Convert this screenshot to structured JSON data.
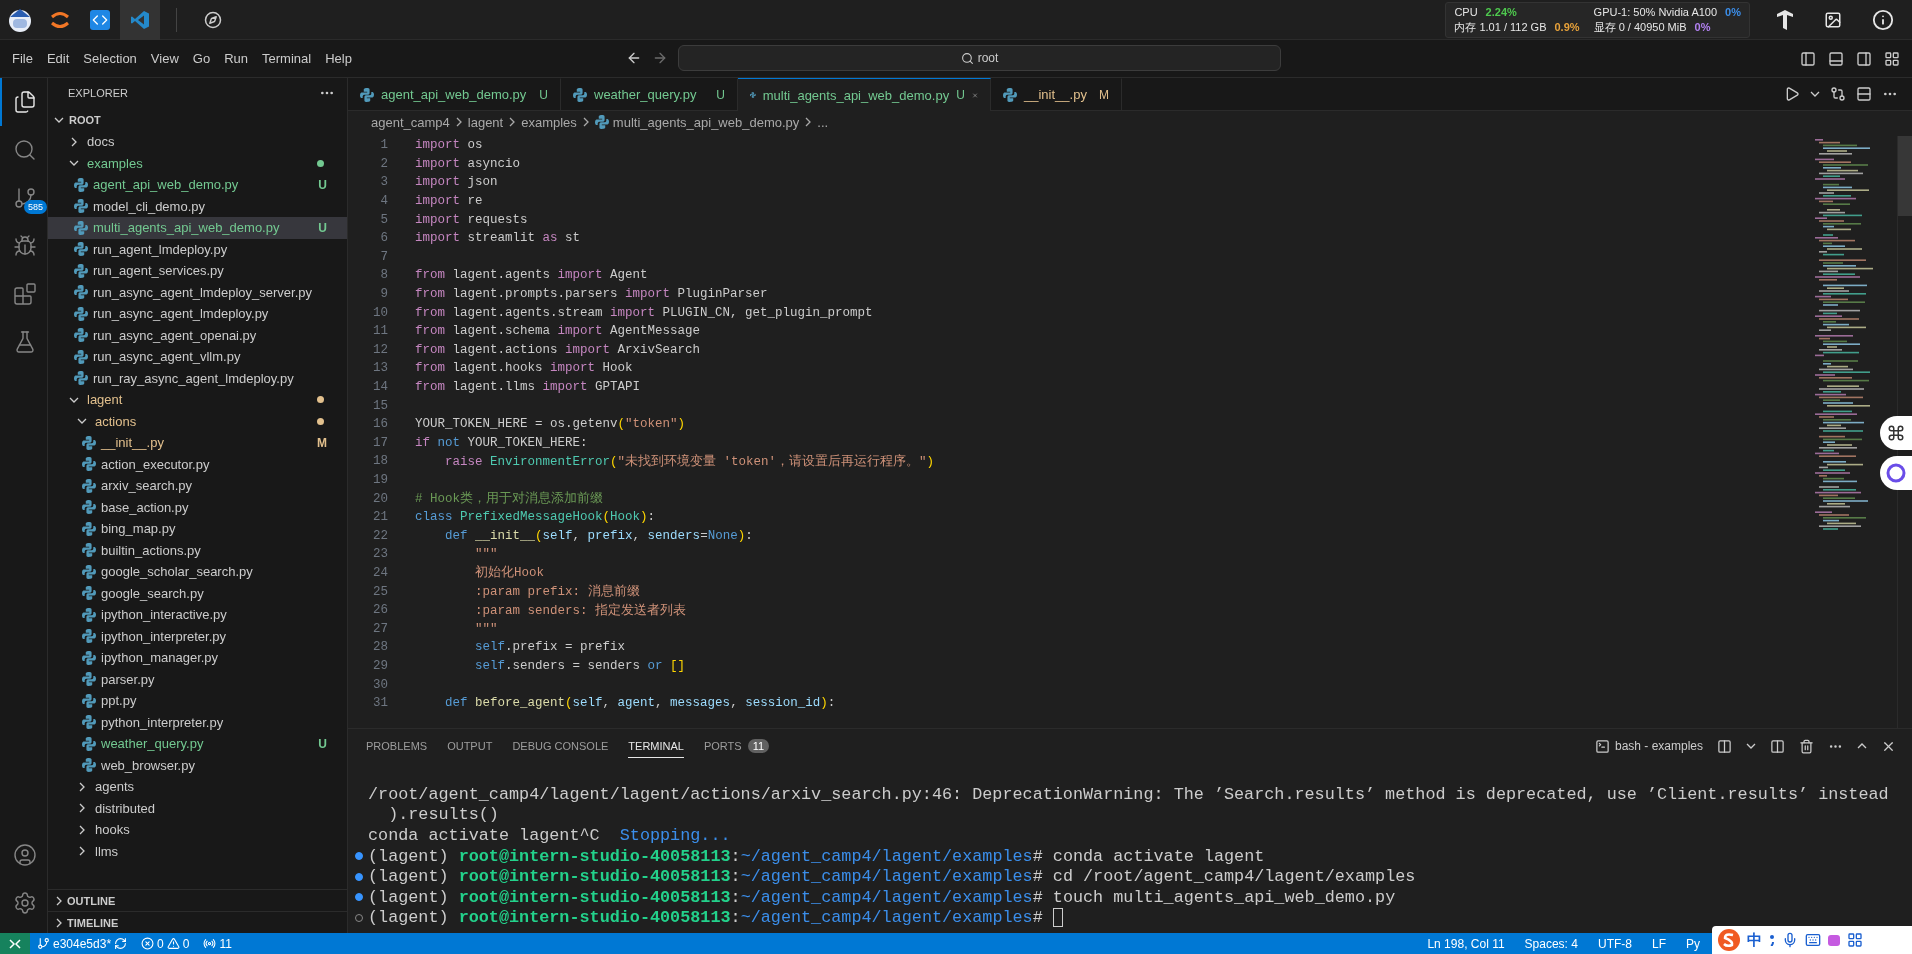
{
  "system_bar": {
    "apps": [
      {
        "kind": "mascot",
        "selected": false
      },
      {
        "kind": "jupyter",
        "selected": false
      },
      {
        "kind": "code",
        "selected": false
      },
      {
        "kind": "vscode",
        "selected": true
      },
      {
        "kind": "compass",
        "selected": false
      }
    ],
    "stats": [
      {
        "label": "CPU",
        "value": "2.24%",
        "color": "#4ec94e"
      },
      {
        "label": "GPU-1: 50% Nvidia A100",
        "value": "0%",
        "color": "#3b8eea"
      },
      {
        "label": "内存 1.01 / 112 GB",
        "value": "0.9%",
        "color": "#e8a23a"
      },
      {
        "label": "显存 0 / 40950 MiB",
        "value": "0%",
        "color": "#b180f0"
      }
    ]
  },
  "menu": [
    "File",
    "Edit",
    "Selection",
    "View",
    "Go",
    "Run",
    "Terminal",
    "Help"
  ],
  "command_center": {
    "text": "root"
  },
  "activity_bar": [
    {
      "kind": "explorer",
      "selected": true
    },
    {
      "kind": "search",
      "selected": false
    },
    {
      "kind": "source_control",
      "selected": false,
      "badge": "585"
    },
    {
      "kind": "run_debug",
      "selected": false
    },
    {
      "kind": "extensions",
      "selected": false
    },
    {
      "kind": "testing",
      "selected": false
    }
  ],
  "explorer": {
    "title": "EXPLORER",
    "root": "ROOT",
    "tree": [
      {
        "label": "docs",
        "kind": "folder",
        "expanded": false,
        "selected": false
      },
      {
        "label": "examples",
        "kind": "folder",
        "expanded": true,
        "selected": false,
        "color": "#73c991",
        "children": [
          {
            "label": "agent_api_web_demo.py",
            "kind": "file",
            "selected": false,
            "color": "#73c991",
            "badge": "U"
          },
          {
            "label": "model_cli_demo.py",
            "kind": "file",
            "selected": false
          },
          {
            "label": "multi_agents_api_web_demo.py",
            "kind": "file",
            "selected": true,
            "color": "#73c991",
            "badge": "U"
          },
          {
            "label": "run_agent_lmdeploy.py",
            "kind": "file",
            "selected": false
          },
          {
            "label": "run_agent_services.py",
            "kind": "file",
            "selected": false
          },
          {
            "label": "run_async_agent_lmdeploy_server.py",
            "kind": "file",
            "selected": false
          },
          {
            "label": "run_async_agent_lmdeploy.py",
            "kind": "file",
            "selected": false
          },
          {
            "label": "run_async_agent_openai.py",
            "kind": "file",
            "selected": false
          },
          {
            "label": "run_async_agent_vllm.py",
            "kind": "file",
            "selected": false
          },
          {
            "label": "run_ray_async_agent_lmdeploy.py",
            "kind": "file",
            "selected": false
          }
        ]
      },
      {
        "label": "lagent",
        "kind": "folder",
        "expanded": true,
        "selected": false,
        "color": "#e2c08d",
        "children": [
          {
            "label": "actions",
            "kind": "folder",
            "expanded": true,
            "selected": false,
            "color": "#e2c08d",
            "children": [
              {
                "label": "__init__.py",
                "kind": "file",
                "selected": false,
                "color": "#e2c08d",
                "badge": "M"
              },
              {
                "label": "action_executor.py",
                "kind": "file",
                "selected": false
              },
              {
                "label": "arxiv_search.py",
                "kind": "file",
                "selected": false
              },
              {
                "label": "base_action.py",
                "kind": "file",
                "selected": false
              },
              {
                "label": "bing_map.py",
                "kind": "file",
                "selected": false
              },
              {
                "label": "builtin_actions.py",
                "kind": "file",
                "selected": false
              },
              {
                "label": "google_scholar_search.py",
                "kind": "file",
                "selected": false
              },
              {
                "label": "google_search.py",
                "kind": "file",
                "selected": false
              },
              {
                "label": "ipython_interactive.py",
                "kind": "file",
                "selected": false
              },
              {
                "label": "ipython_interpreter.py",
                "kind": "file",
                "selected": false
              },
              {
                "label": "ipython_manager.py",
                "kind": "file",
                "selected": false
              },
              {
                "label": "parser.py",
                "kind": "file",
                "selected": false
              },
              {
                "label": "ppt.py",
                "kind": "file",
                "selected": false
              },
              {
                "label": "python_interpreter.py",
                "kind": "file",
                "selected": false
              },
              {
                "label": "weather_query.py",
                "kind": "file",
                "selected": false,
                "color": "#73c991",
                "badge": "U"
              },
              {
                "label": "web_browser.py",
                "kind": "file",
                "selected": false
              }
            ]
          },
          {
            "label": "agents",
            "kind": "folder",
            "expanded": false,
            "selected": false
          },
          {
            "label": "distributed",
            "kind": "folder",
            "expanded": false,
            "selected": false
          },
          {
            "label": "hooks",
            "kind": "folder",
            "expanded": false,
            "selected": false
          },
          {
            "label": "llms",
            "kind": "folder",
            "expanded": false,
            "selected": false
          }
        ]
      }
    ],
    "sections": [
      {
        "label": "OUTLINE",
        "expanded": false
      },
      {
        "label": "TIMELINE",
        "expanded": false
      }
    ]
  },
  "tabs": [
    {
      "label": "agent_api_web_demo.py",
      "badge": "U",
      "color": "#73c991",
      "selected": false
    },
    {
      "label": "weather_query.py",
      "badge": "U",
      "color": "#73c991",
      "selected": false
    },
    {
      "label": "multi_agents_api_web_demo.py",
      "badge": "U",
      "color": "#73c991",
      "selected": true
    },
    {
      "label": "__init__.py",
      "badge": "M",
      "color": "#e2c08d",
      "selected": false
    }
  ],
  "breadcrumb": [
    {
      "text": "agent_camp4",
      "kind": "folder"
    },
    {
      "text": "lagent",
      "kind": "folder"
    },
    {
      "text": "examples",
      "kind": "folder"
    },
    {
      "text": "multi_agents_api_web_demo.py",
      "kind": "file"
    },
    {
      "text": "...",
      "kind": "more"
    }
  ],
  "editor": {
    "lines": [
      {
        "number": "1",
        "tokens": [
          {
            "kind": "kw",
            "text": "import"
          },
          {
            "kind": "tx",
            "text": " os"
          }
        ]
      },
      {
        "number": "2",
        "tokens": [
          {
            "kind": "kw",
            "text": "import"
          },
          {
            "kind": "tx",
            "text": " asyncio"
          }
        ]
      },
      {
        "number": "3",
        "tokens": [
          {
            "kind": "kw",
            "text": "import"
          },
          {
            "kind": "tx",
            "text": " json"
          }
        ]
      },
      {
        "number": "4",
        "tokens": [
          {
            "kind": "kw",
            "text": "import"
          },
          {
            "kind": "tx",
            "text": " re"
          }
        ]
      },
      {
        "number": "5",
        "tokens": [
          {
            "kind": "kw",
            "text": "import"
          },
          {
            "kind": "tx",
            "text": " requests"
          }
        ]
      },
      {
        "number": "6",
        "tokens": [
          {
            "kind": "kw",
            "text": "import"
          },
          {
            "kind": "tx",
            "text": " streamlit "
          },
          {
            "kind": "kw",
            "text": "as"
          },
          {
            "kind": "tx",
            "text": " st"
          }
        ]
      },
      {
        "number": "7"
      },
      {
        "number": "8",
        "tokens": [
          {
            "kind": "kw",
            "text": "from"
          },
          {
            "kind": "tx",
            "text": " lagent.agents "
          },
          {
            "kind": "kw",
            "text": "import"
          },
          {
            "kind": "tx",
            "text": " Agent"
          }
        ]
      },
      {
        "number": "9",
        "tokens": [
          {
            "kind": "kw",
            "text": "from"
          },
          {
            "kind": "tx",
            "text": " lagent.prompts.parsers "
          },
          {
            "kind": "kw",
            "text": "import"
          },
          {
            "kind": "tx",
            "text": " PluginParser"
          }
        ]
      },
      {
        "number": "10",
        "tokens": [
          {
            "kind": "kw",
            "text": "from"
          },
          {
            "kind": "tx",
            "text": " lagent.agents.stream "
          },
          {
            "kind": "kw",
            "text": "import"
          },
          {
            "kind": "tx",
            "text": " PLUGIN_CN, get_plugin_prompt"
          }
        ]
      },
      {
        "number": "11",
        "tokens": [
          {
            "kind": "kw",
            "text": "from"
          },
          {
            "kind": "tx",
            "text": " lagent.schema "
          },
          {
            "kind": "kw",
            "text": "import"
          },
          {
            "kind": "tx",
            "text": " AgentMessage"
          }
        ]
      },
      {
        "number": "12",
        "tokens": [
          {
            "kind": "kw",
            "text": "from"
          },
          {
            "kind": "tx",
            "text": " lagent.actions "
          },
          {
            "kind": "kw",
            "text": "import"
          },
          {
            "kind": "tx",
            "text": " ArxivSearch"
          }
        ]
      },
      {
        "number": "13",
        "tokens": [
          {
            "kind": "kw",
            "text": "from"
          },
          {
            "kind": "tx",
            "text": " lagent.hooks "
          },
          {
            "kind": "kw",
            "text": "import"
          },
          {
            "kind": "tx",
            "text": " Hook"
          }
        ]
      },
      {
        "number": "14",
        "tokens": [
          {
            "kind": "kw",
            "text": "from"
          },
          {
            "kind": "tx",
            "text": " lagent.llms "
          },
          {
            "kind": "kw",
            "text": "import"
          },
          {
            "kind": "tx",
            "text": " GPTAPI"
          }
        ]
      },
      {
        "number": "15"
      },
      {
        "number": "16",
        "tokens": [
          {
            "kind": "tx",
            "text": "YOUR_TOKEN_HERE = os.getenv"
          },
          {
            "kind": "br",
            "text": "("
          },
          {
            "kind": "str",
            "text": "\"token\""
          },
          {
            "kind": "br",
            "text": ")"
          }
        ]
      },
      {
        "number": "17",
        "tokens": [
          {
            "kind": "kw",
            "text": "if "
          },
          {
            "kind": "st",
            "text": "not"
          },
          {
            "kind": "tx",
            "text": " YOUR_TOKEN_HERE:"
          }
        ]
      },
      {
        "number": "18",
        "tokens": [
          {
            "kind": "kw",
            "text": "    raise "
          },
          {
            "kind": "cls",
            "text": "EnvironmentError"
          },
          {
            "kind": "br",
            "text": "("
          },
          {
            "kind": "str",
            "text": "\"未找到环境变量 'token'，请设置后再运行程序。\""
          },
          {
            "kind": "br",
            "text": ")"
          }
        ]
      },
      {
        "number": "19"
      },
      {
        "number": "20",
        "tokens": [
          {
            "kind": "cm",
            "text": "# Hook类，用于对消息添加前缀"
          }
        ]
      },
      {
        "number": "21",
        "tokens": [
          {
            "kind": "st",
            "text": "class "
          },
          {
            "kind": "cls",
            "text": "PrefixedMessageHook"
          },
          {
            "kind": "br",
            "text": "("
          },
          {
            "kind": "cls",
            "text": "Hook"
          },
          {
            "kind": "br",
            "text": ")"
          },
          {
            "kind": "tx",
            "text": ":"
          }
        ]
      },
      {
        "number": "22",
        "tokens": [
          {
            "kind": "st",
            "text": "    def "
          },
          {
            "kind": "fn",
            "text": "__init__"
          },
          {
            "kind": "br",
            "text": "("
          },
          {
            "kind": "param",
            "text": "self"
          },
          {
            "kind": "tx",
            "text": ", "
          },
          {
            "kind": "param",
            "text": "prefix"
          },
          {
            "kind": "tx",
            "text": ", "
          },
          {
            "kind": "param",
            "text": "senders"
          },
          {
            "kind": "tx",
            "text": "="
          },
          {
            "kind": "st",
            "text": "None"
          },
          {
            "kind": "br",
            "text": ")"
          },
          {
            "kind": "tx",
            "text": ":"
          }
        ]
      },
      {
        "number": "23",
        "tokens": [
          {
            "kind": "str",
            "text": "        \"\"\""
          }
        ]
      },
      {
        "number": "24",
        "tokens": [
          {
            "kind": "str",
            "text": "        初始化Hook"
          }
        ]
      },
      {
        "number": "25",
        "tokens": [
          {
            "kind": "str",
            "text": "        :param prefix: 消息前缀"
          }
        ]
      },
      {
        "number": "26",
        "tokens": [
          {
            "kind": "str",
            "text": "        :param senders: 指定发送者列表"
          }
        ]
      },
      {
        "number": "27",
        "tokens": [
          {
            "kind": "str",
            "text": "        \"\"\""
          }
        ]
      },
      {
        "number": "28",
        "tokens": [
          {
            "kind": "st",
            "text": "        self"
          },
          {
            "kind": "tx",
            "text": ".prefix = prefix"
          }
        ]
      },
      {
        "number": "29",
        "tokens": [
          {
            "kind": "st",
            "text": "        self"
          },
          {
            "kind": "tx",
            "text": ".senders = senders "
          },
          {
            "kind": "st",
            "text": "or"
          },
          {
            "kind": "br",
            "text": " []"
          }
        ]
      },
      {
        "number": "30"
      },
      {
        "number": "31",
        "tokens": [
          {
            "kind": "st",
            "text": "    def "
          },
          {
            "kind": "fn",
            "text": "before_agent"
          },
          {
            "kind": "br",
            "text": "("
          },
          {
            "kind": "param",
            "text": "self"
          },
          {
            "kind": "tx",
            "text": ", "
          },
          {
            "kind": "param",
            "text": "agent"
          },
          {
            "kind": "tx",
            "text": ", "
          },
          {
            "kind": "param",
            "text": "messages"
          },
          {
            "kind": "tx",
            "text": ", "
          },
          {
            "kind": "param",
            "text": "session_id"
          },
          {
            "kind": "br",
            "text": ")"
          },
          {
            "kind": "tx",
            "text": ":"
          }
        ]
      }
    ]
  },
  "panel": {
    "tabs": [
      {
        "label": "PROBLEMS",
        "selected": false
      },
      {
        "label": "OUTPUT",
        "selected": false
      },
      {
        "label": "DEBUG CONSOLE",
        "selected": false
      },
      {
        "label": "TERMINAL",
        "selected": true
      },
      {
        "label": "PORTS",
        "selected": false,
        "badge": "11"
      }
    ],
    "terminal_name": "bash - examples",
    "lines": [
      {
        "segments": [
          {
            "kind": "plain",
            "text": "/root/agent_camp4/lagent/lagent/actions/arxiv_search.py:46: DeprecationWarning: The ’Search.results’ method is deprecated, use ’Client.results’ instead"
          }
        ]
      },
      {
        "segments": [
          {
            "kind": "plain",
            "text": "  ).results()"
          }
        ]
      },
      {
        "segments": [
          {
            "kind": "plain",
            "text": "conda activate lagent^C  "
          },
          {
            "kind": "info",
            "text": "Stopping..."
          }
        ]
      },
      {
        "finished": true,
        "segments": [
          {
            "kind": "plain",
            "text": "(lagent) "
          },
          {
            "kind": "user",
            "text": "root@intern-studio-40058113"
          },
          {
            "kind": "plain",
            "text": ":"
          },
          {
            "kind": "path",
            "text": "~/agent_camp4/lagent/examples"
          },
          {
            "kind": "plain",
            "text": "# conda activate lagent"
          }
        ]
      },
      {
        "finished": true,
        "segments": [
          {
            "kind": "plain",
            "text": "(lagent) "
          },
          {
            "kind": "user",
            "text": "root@intern-studio-40058113"
          },
          {
            "kind": "plain",
            "text": ":"
          },
          {
            "kind": "path",
            "text": "~/agent_camp4/lagent/examples"
          },
          {
            "kind": "plain",
            "text": "# cd /root/agent_camp4/lagent/examples"
          }
        ]
      },
      {
        "finished": true,
        "segments": [
          {
            "kind": "plain",
            "text": "(lagent) "
          },
          {
            "kind": "user",
            "text": "root@intern-studio-40058113"
          },
          {
            "kind": "plain",
            "text": ":"
          },
          {
            "kind": "path",
            "text": "~/agent_camp4/lagent/examples"
          },
          {
            "kind": "plain",
            "text": "# touch multi_agents_api_web_demo.py"
          }
        ]
      },
      {
        "finished": false,
        "cursor": true,
        "segments": [
          {
            "kind": "plain",
            "text": "(lagent) "
          },
          {
            "kind": "user",
            "text": "root@intern-studio-40058113"
          },
          {
            "kind": "plain",
            "text": ":"
          },
          {
            "kind": "path",
            "text": "~/agent_camp4/lagent/examples"
          },
          {
            "kind": "plain",
            "text": "#"
          }
        ]
      }
    ]
  },
  "status_bar": {
    "branch": "e304e5d3*",
    "errors": "0",
    "warnings": "0",
    "ports": "11",
    "items": [
      "Ln 198, Col 11",
      "Spaces: 4",
      "UTF-8",
      "LF",
      "Py"
    ]
  },
  "ime_bar": {
    "mode": "中"
  }
}
